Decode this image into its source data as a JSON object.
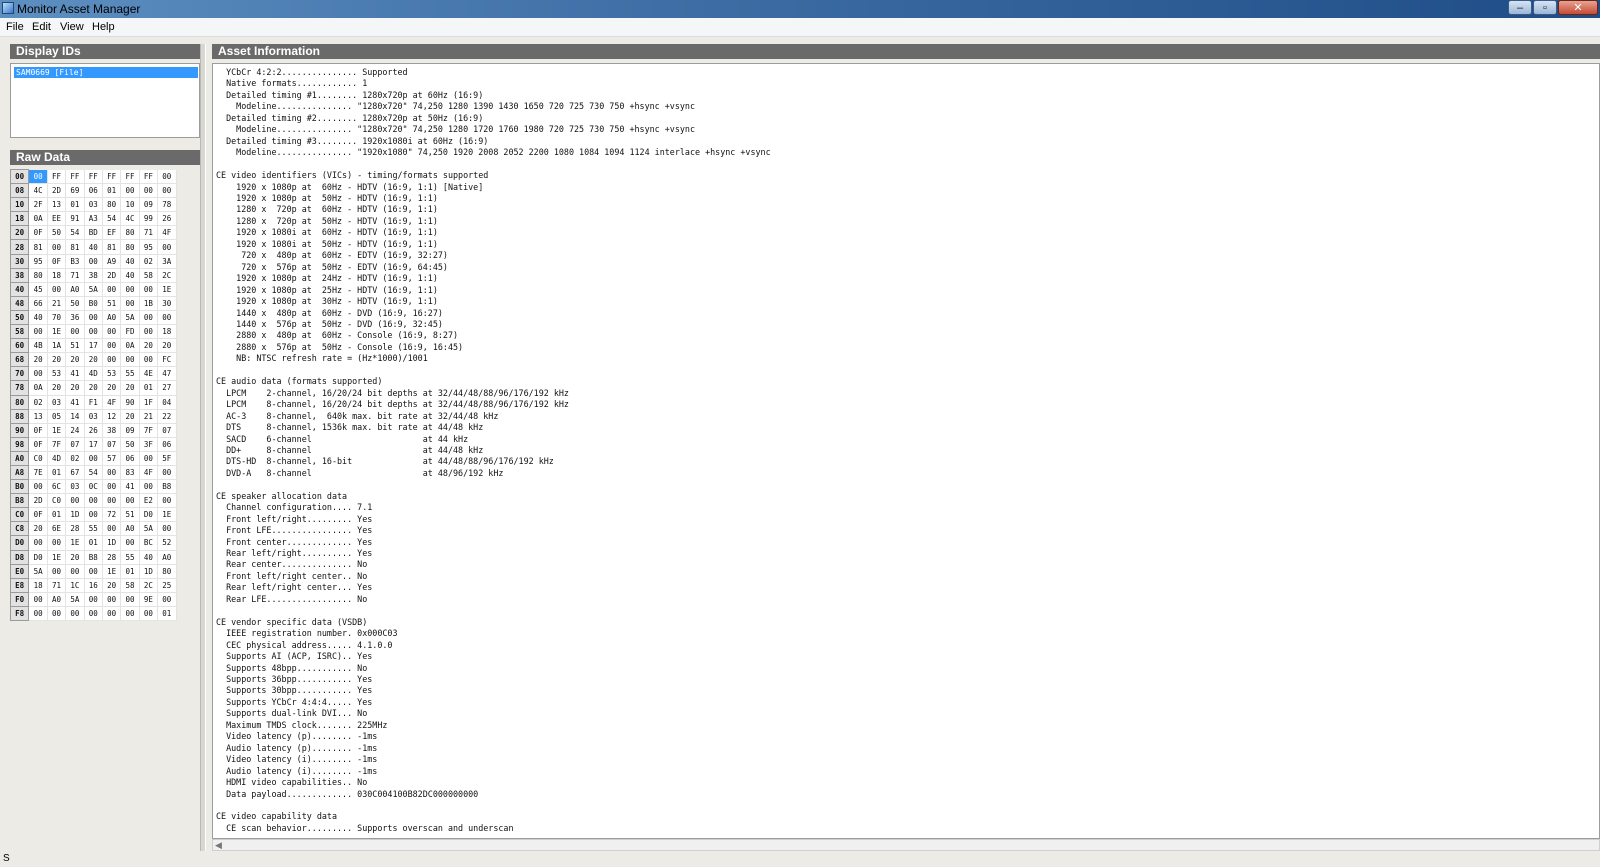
{
  "window": {
    "title": "Monitor Asset Manager",
    "buttons": {
      "minimize": "–",
      "maximize": "▫",
      "close": "✕"
    }
  },
  "menu": [
    "File",
    "Edit",
    "View",
    "Help"
  ],
  "display_ids": {
    "header": "Display IDs",
    "items": [
      "SAM0669  [File]"
    ]
  },
  "raw_data": {
    "header": "Raw Data",
    "rows": [
      [
        "00",
        "00",
        "FF",
        "FF",
        "FF",
        "FF",
        "FF",
        "FF",
        "00"
      ],
      [
        "08",
        "4C",
        "2D",
        "69",
        "06",
        "01",
        "00",
        "00",
        "00"
      ],
      [
        "10",
        "2F",
        "13",
        "01",
        "03",
        "80",
        "10",
        "09",
        "78"
      ],
      [
        "18",
        "0A",
        "EE",
        "91",
        "A3",
        "54",
        "4C",
        "99",
        "26"
      ],
      [
        "20",
        "0F",
        "50",
        "54",
        "BD",
        "EF",
        "80",
        "71",
        "4F"
      ],
      [
        "28",
        "81",
        "00",
        "81",
        "40",
        "81",
        "80",
        "95",
        "00"
      ],
      [
        "30",
        "95",
        "0F",
        "B3",
        "00",
        "A9",
        "40",
        "02",
        "3A"
      ],
      [
        "38",
        "80",
        "18",
        "71",
        "38",
        "2D",
        "40",
        "58",
        "2C"
      ],
      [
        "40",
        "45",
        "00",
        "A0",
        "5A",
        "00",
        "00",
        "00",
        "1E"
      ],
      [
        "48",
        "66",
        "21",
        "50",
        "B0",
        "51",
        "00",
        "1B",
        "30"
      ],
      [
        "50",
        "40",
        "70",
        "36",
        "00",
        "A0",
        "5A",
        "00",
        "00"
      ],
      [
        "58",
        "00",
        "1E",
        "00",
        "00",
        "00",
        "FD",
        "00",
        "18"
      ],
      [
        "60",
        "4B",
        "1A",
        "51",
        "17",
        "00",
        "0A",
        "20",
        "20"
      ],
      [
        "68",
        "20",
        "20",
        "20",
        "20",
        "00",
        "00",
        "00",
        "FC"
      ],
      [
        "70",
        "00",
        "53",
        "41",
        "4D",
        "53",
        "55",
        "4E",
        "47"
      ],
      [
        "78",
        "0A",
        "20",
        "20",
        "20",
        "20",
        "20",
        "01",
        "27"
      ],
      [
        "80",
        "02",
        "03",
        "41",
        "F1",
        "4F",
        "90",
        "1F",
        "04"
      ],
      [
        "88",
        "13",
        "05",
        "14",
        "03",
        "12",
        "20",
        "21",
        "22"
      ],
      [
        "90",
        "0F",
        "1E",
        "24",
        "26",
        "38",
        "09",
        "7F",
        "07"
      ],
      [
        "98",
        "0F",
        "7F",
        "07",
        "17",
        "07",
        "50",
        "3F",
        "06"
      ],
      [
        "A0",
        "C0",
        "4D",
        "02",
        "00",
        "57",
        "06",
        "00",
        "5F"
      ],
      [
        "A8",
        "7E",
        "01",
        "67",
        "54",
        "00",
        "83",
        "4F",
        "00"
      ],
      [
        "B0",
        "00",
        "6C",
        "03",
        "0C",
        "00",
        "41",
        "00",
        "B8"
      ],
      [
        "B8",
        "2D",
        "C0",
        "00",
        "00",
        "00",
        "00",
        "E2",
        "00"
      ],
      [
        "C0",
        "0F",
        "01",
        "1D",
        "00",
        "72",
        "51",
        "D0",
        "1E"
      ],
      [
        "C8",
        "20",
        "6E",
        "28",
        "55",
        "00",
        "A0",
        "5A",
        "00"
      ],
      [
        "D0",
        "00",
        "00",
        "1E",
        "01",
        "1D",
        "00",
        "BC",
        "52"
      ],
      [
        "D8",
        "D0",
        "1E",
        "20",
        "B8",
        "28",
        "55",
        "40",
        "A0"
      ],
      [
        "E0",
        "5A",
        "00",
        "00",
        "00",
        "1E",
        "01",
        "1D",
        "80"
      ],
      [
        "E8",
        "18",
        "71",
        "1C",
        "16",
        "20",
        "58",
        "2C",
        "25"
      ],
      [
        "F0",
        "00",
        "A0",
        "5A",
        "00",
        "00",
        "00",
        "9E",
        "00"
      ],
      [
        "F8",
        "00",
        "00",
        "00",
        "00",
        "00",
        "00",
        "00",
        "01"
      ]
    ]
  },
  "asset_info": {
    "header": "Asset Information",
    "lines": [
      "  YCbCr 4:2:2............... Supported",
      "  Native formats............ 1",
      "  Detailed timing #1........ 1280x720p at 60Hz (16:9)",
      "    Modeline............... \"1280x720\" 74,250 1280 1390 1430 1650 720 725 730 750 +hsync +vsync",
      "  Detailed timing #2........ 1280x720p at 50Hz (16:9)",
      "    Modeline............... \"1280x720\" 74,250 1280 1720 1760 1980 720 725 730 750 +hsync +vsync",
      "  Detailed timing #3........ 1920x1080i at 60Hz (16:9)",
      "    Modeline............... \"1920x1080\" 74,250 1920 2008 2052 2200 1080 1084 1094 1124 interlace +hsync +vsync",
      "",
      "CE video identifiers (VICs) - timing/formats supported",
      "    1920 x 1080p at  60Hz - HDTV (16:9, 1:1) [Native]",
      "    1920 x 1080p at  50Hz - HDTV (16:9, 1:1)",
      "    1280 x  720p at  60Hz - HDTV (16:9, 1:1)",
      "    1280 x  720p at  50Hz - HDTV (16:9, 1:1)",
      "    1920 x 1080i at  60Hz - HDTV (16:9, 1:1)",
      "    1920 x 1080i at  50Hz - HDTV (16:9, 1:1)",
      "     720 x  480p at  60Hz - EDTV (16:9, 32:27)",
      "     720 x  576p at  50Hz - EDTV (16:9, 64:45)",
      "    1920 x 1080p at  24Hz - HDTV (16:9, 1:1)",
      "    1920 x 1080p at  25Hz - HDTV (16:9, 1:1)",
      "    1920 x 1080p at  30Hz - HDTV (16:9, 1:1)",
      "    1440 x  480p at  60Hz - DVD (16:9, 16:27)",
      "    1440 x  576p at  50Hz - DVD (16:9, 32:45)",
      "    2880 x  480p at  60Hz - Console (16:9, 8:27)",
      "    2880 x  576p at  50Hz - Console (16:9, 16:45)",
      "    NB: NTSC refresh rate = (Hz*1000)/1001",
      "",
      "CE audio data (formats supported)",
      "  LPCM    2-channel, 16/20/24 bit depths at 32/44/48/88/96/176/192 kHz",
      "  LPCM    8-channel, 16/20/24 bit depths at 32/44/48/88/96/176/192 kHz",
      "  AC-3    8-channel,  640k max. bit rate at 32/44/48 kHz",
      "  DTS     8-channel, 1536k max. bit rate at 44/48 kHz",
      "  SACD    6-channel                      at 44 kHz",
      "  DD+     8-channel                      at 44/48 kHz",
      "  DTS-HD  8-channel, 16-bit              at 44/48/88/96/176/192 kHz",
      "  DVD-A   8-channel                      at 48/96/192 kHz",
      "",
      "CE speaker allocation data",
      "  Channel configuration.... 7.1",
      "  Front left/right......... Yes",
      "  Front LFE................ Yes",
      "  Front center............. Yes",
      "  Rear left/right.......... Yes",
      "  Rear center.............. No",
      "  Front left/right center.. No",
      "  Rear left/right center... Yes",
      "  Rear LFE................. No",
      "",
      "CE vendor specific data (VSDB)",
      "  IEEE registration number. 0x000C03",
      "  CEC physical address..... 4.1.0.0",
      "  Supports AI (ACP, ISRC).. Yes",
      "  Supports 48bpp........... No",
      "  Supports 36bpp........... Yes",
      "  Supports 30bpp........... Yes",
      "  Supports YCbCr 4:4:4..... Yes",
      "  Supports dual-link DVI... No",
      "  Maximum TMDS clock....... 225MHz",
      "  Video latency (p)........ -1ms",
      "  Audio latency (p)........ -1ms",
      "  Video latency (i)........ -1ms",
      "  Audio latency (i)........ -1ms",
      "  HDMI video capabilities.. No",
      "  Data payload............. 030C004100B82DC000000000",
      "",
      "CE video capability data",
      "  CE scan behavior......... Supports overscan and underscan"
    ]
  },
  "status": {
    "text": "S"
  }
}
